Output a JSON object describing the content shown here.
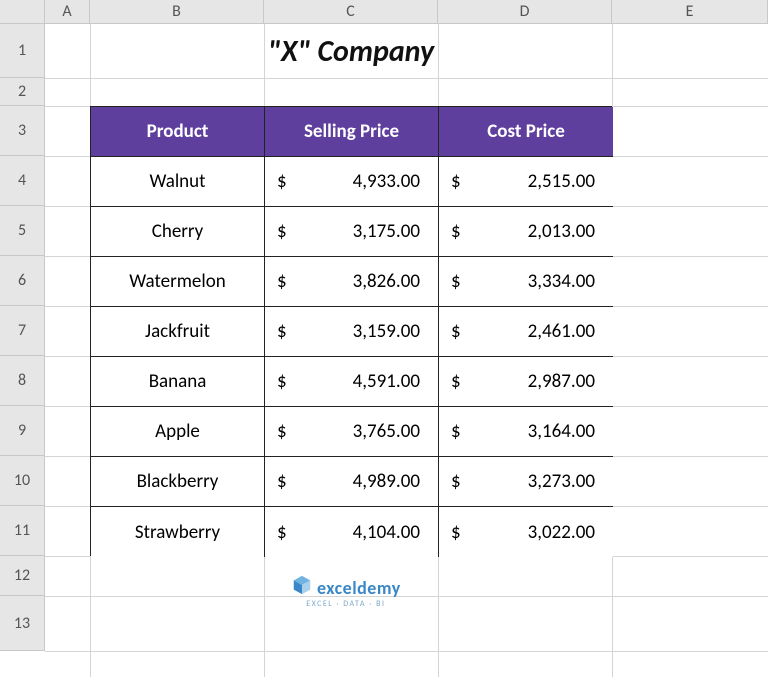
{
  "columns": [
    "A",
    "B",
    "C",
    "D",
    "E"
  ],
  "rows": [
    "1",
    "2",
    "3",
    "4",
    "5",
    "6",
    "7",
    "8",
    "9",
    "10",
    "11",
    "12",
    "13"
  ],
  "title": "\"X\" Company",
  "headers": {
    "product": "Product",
    "selling": "Selling Price",
    "cost": "Cost Price"
  },
  "data": [
    {
      "product": "Walnut",
      "selling": "4,933.00",
      "cost": "2,515.00"
    },
    {
      "product": "Cherry",
      "selling": "3,175.00",
      "cost": "2,013.00"
    },
    {
      "product": "Watermelon",
      "selling": "3,826.00",
      "cost": "3,334.00"
    },
    {
      "product": "Jackfruit",
      "selling": "3,159.00",
      "cost": "2,461.00"
    },
    {
      "product": "Banana",
      "selling": "4,591.00",
      "cost": "2,987.00"
    },
    {
      "product": "Apple",
      "selling": "3,765.00",
      "cost": "3,164.00"
    },
    {
      "product": "Blackberry",
      "selling": "4,989.00",
      "cost": "3,273.00"
    },
    {
      "product": "Strawberry",
      "selling": "4,104.00",
      "cost": "3,022.00"
    }
  ],
  "currency_symbol": "$",
  "logo": {
    "name": "exceldemy",
    "tagline": "EXCEL · DATA · BI"
  },
  "chart_data": {
    "type": "table",
    "title": "\"X\" Company",
    "columns": [
      "Product",
      "Selling Price",
      "Cost Price"
    ],
    "rows": [
      [
        "Walnut",
        4933.0,
        2515.0
      ],
      [
        "Cherry",
        3175.0,
        2013.0
      ],
      [
        "Watermelon",
        3826.0,
        3334.0
      ],
      [
        "Jackfruit",
        3159.0,
        2461.0
      ],
      [
        "Banana",
        4591.0,
        2987.0
      ],
      [
        "Apple",
        3765.0,
        3164.0
      ],
      [
        "Blackberry",
        4989.0,
        3273.0
      ],
      [
        "Strawberry",
        4104.0,
        3022.0
      ]
    ]
  }
}
